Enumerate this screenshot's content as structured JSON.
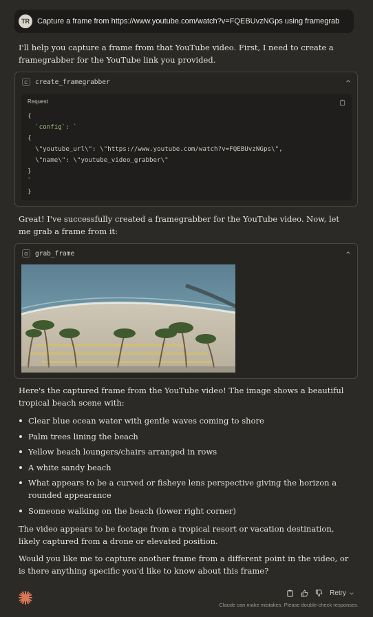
{
  "user_message": {
    "avatar_initials": "TR",
    "text": "Capture a frame from https://www.youtube.com/watch?v=FQEBUvzNGps using framegrab"
  },
  "assistant": {
    "intro": "I'll help you capture a frame from that YouTube video. First, I need to create a framegrabber for the YouTube link you provided.",
    "tool1": {
      "badge": "C",
      "name": "create_framegrabber",
      "request_label": "Request",
      "code_lines": [
        "{",
        "  `config`: `",
        "{",
        "  \\\"youtube_url\\\": \\\"https://www.youtube.com/watch?v=FQEBUvzNGps\\\",",
        "  \\\"name\\\": \\\"youtube_video_grabber\\\"",
        "}",
        "`",
        "}"
      ]
    },
    "after_tool1": "Great! I've successfully created a framegrabber for the YouTube video. Now, let me grab a frame from it:",
    "tool2": {
      "badge": "G",
      "name": "grab_frame"
    },
    "after_tool2": "Here's the captured frame from the YouTube video! The image shows a beautiful tropical beach scene with:",
    "bullets": [
      "Clear blue ocean water with gentle waves coming to shore",
      "Palm trees lining the beach",
      "Yellow beach loungers/chairs arranged in rows",
      "A white sandy beach",
      "What appears to be a curved or fisheye lens perspective giving the horizon a rounded appearance",
      "Someone walking on the beach (lower right corner)"
    ],
    "para_drone": "The video appears to be footage from a tropical resort or vacation destination, likely captured from a drone or elevated position.",
    "para_question": "Would you like me to capture another frame from a different point in the video, or is there anything specific you'd like to know about this frame?"
  },
  "footer": {
    "retry_label": "Retry",
    "disclaimer": "Claude can make mistakes. Please double-check responses."
  },
  "icons": {
    "copy": "copy-icon",
    "thumbs_up": "thumbs-up-icon",
    "thumbs_down": "thumbs-down-icon",
    "chevron": "chevron-down-icon",
    "collapse": "chevron-up-icon",
    "logo": "claude-logo-icon"
  },
  "colors": {
    "background": "#2b2a27",
    "accent_logo": "#d97757",
    "code_key": "#9ab87c"
  }
}
